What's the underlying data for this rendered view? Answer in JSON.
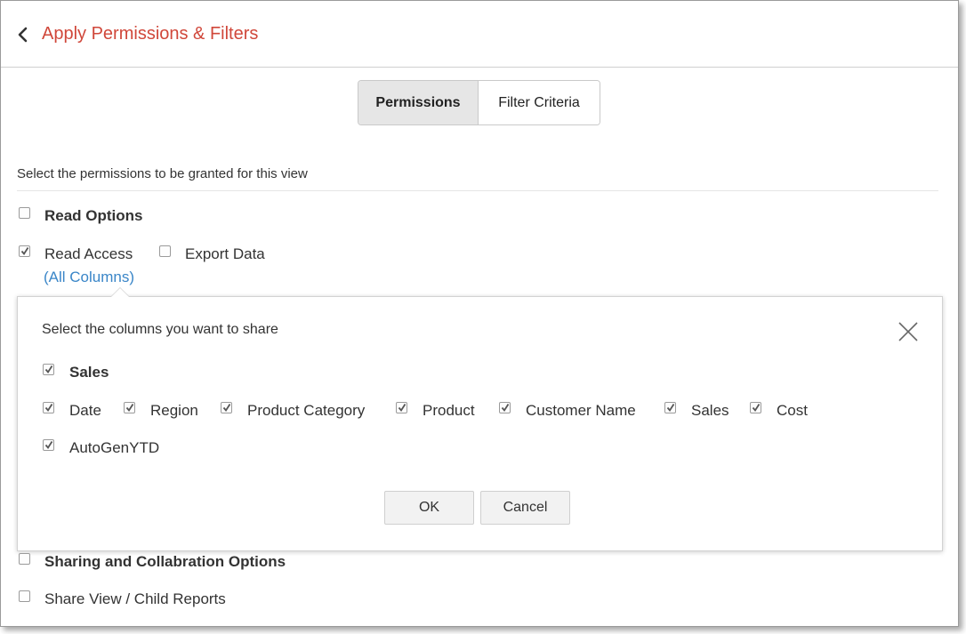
{
  "header": {
    "title": "Apply Permissions & Filters",
    "back_icon": "chevron-left-icon"
  },
  "tabs": [
    {
      "label": "Permissions",
      "active": true
    },
    {
      "label": "Filter Criteria",
      "active": false
    }
  ],
  "section": {
    "instruction": "Select the permissions to be granted for this view",
    "read_options": {
      "label": "Read Options",
      "checked": false
    },
    "read_access": {
      "label": "Read Access",
      "checked": true,
      "columns_link": "(All Columns)"
    },
    "export_data": {
      "label": "Export Data",
      "checked": false
    },
    "sharing_options": {
      "label": "Sharing and Collabration Options",
      "checked": false
    },
    "share_view": {
      "label": "Share View / Child Reports",
      "checked": false
    }
  },
  "column_popup": {
    "title": "Select the columns you want to share",
    "table": {
      "label": "Sales",
      "checked": true
    },
    "columns": [
      {
        "label": "Date",
        "checked": true
      },
      {
        "label": "Region",
        "checked": true
      },
      {
        "label": "Product Category",
        "checked": true
      },
      {
        "label": "Product",
        "checked": true
      },
      {
        "label": "Customer Name",
        "checked": true
      },
      {
        "label": "Sales",
        "checked": true
      },
      {
        "label": "Cost",
        "checked": true
      },
      {
        "label": "AutoGenYTD",
        "checked": true
      }
    ],
    "ok_label": "OK",
    "cancel_label": "Cancel"
  },
  "colors": {
    "title": "#d0473a",
    "link": "#3a86c8",
    "active_tab_bg": "#e6e6e6"
  }
}
